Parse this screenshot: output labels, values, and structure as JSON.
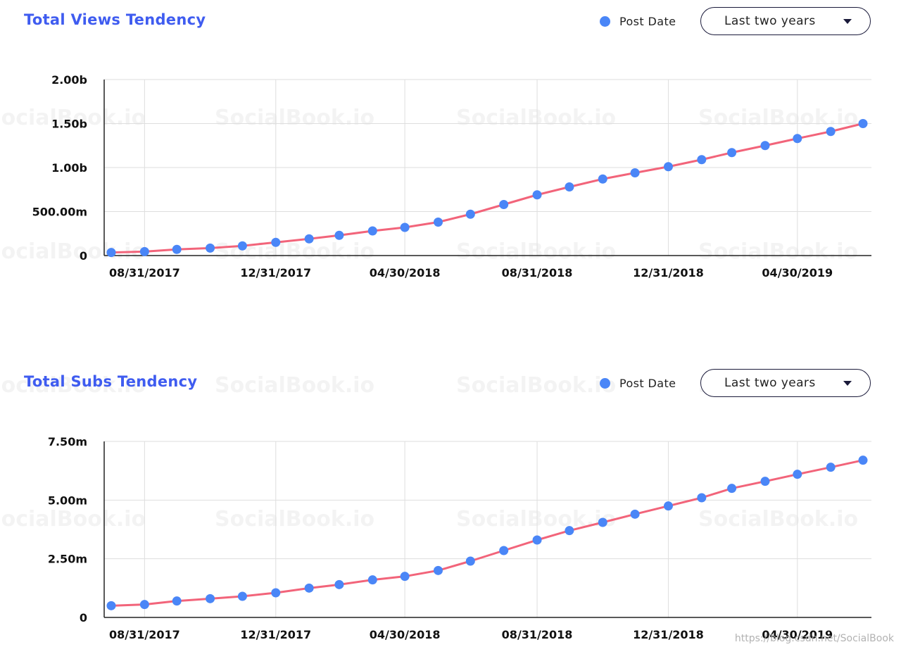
{
  "watermark": "SocialBook.io",
  "footer_credit": "https://blog.csdn.net/SocialBook",
  "accent_color": "#3f5cf0",
  "point_color": "#4a86f7",
  "line_color": "#f2647a",
  "views_panel": {
    "title": "Total Views Tendency",
    "legend_label": "Post Date",
    "dropdown_label": "Last two years"
  },
  "subs_panel": {
    "title": "Total Subs Tendency",
    "legend_label": "Post Date",
    "dropdown_label": "Last two years"
  },
  "chart_data": [
    {
      "type": "line",
      "title": "Total Views Tendency",
      "xlabel": "",
      "ylabel": "",
      "x_tick_labels": [
        "08/31/2017",
        "12/31/2017",
        "04/30/2018",
        "08/31/2018",
        "12/31/2018",
        "04/30/2019"
      ],
      "y_tick_labels": [
        "0",
        "500.00m",
        "1.00b",
        "1.50b",
        "2.00b"
      ],
      "ylim": [
        0,
        2000000000
      ],
      "grid": true,
      "legend": "top-right",
      "series": [
        {
          "name": "Post Date",
          "x": [
            "2017-07-31",
            "2017-08-31",
            "2017-09-30",
            "2017-10-31",
            "2017-11-30",
            "2017-12-31",
            "2018-01-31",
            "2018-02-28",
            "2018-03-31",
            "2018-04-30",
            "2018-05-31",
            "2018-06-30",
            "2018-07-31",
            "2018-08-31",
            "2018-09-30",
            "2018-10-31",
            "2018-11-30",
            "2018-12-31",
            "2019-01-31",
            "2019-02-28",
            "2019-03-31",
            "2019-04-30",
            "2019-05-31",
            "2019-06-30"
          ],
          "values": [
            35000000,
            45000000,
            70000000,
            85000000,
            110000000,
            150000000,
            190000000,
            230000000,
            280000000,
            320000000,
            380000000,
            470000000,
            580000000,
            690000000,
            780000000,
            870000000,
            940000000,
            1010000000,
            1090000000,
            1170000000,
            1250000000,
            1330000000,
            1410000000,
            1500000000
          ]
        }
      ]
    },
    {
      "type": "line",
      "title": "Total Subs Tendency",
      "xlabel": "",
      "ylabel": "",
      "x_tick_labels": [
        "08/31/2017",
        "12/31/2017",
        "04/30/2018",
        "08/31/2018",
        "12/31/2018",
        "04/30/2019"
      ],
      "y_tick_labels": [
        "0",
        "2.50m",
        "5.00m",
        "7.50m"
      ],
      "ylim": [
        0,
        7500000
      ],
      "grid": true,
      "legend": "top-right",
      "series": [
        {
          "name": "Post Date",
          "x": [
            "2017-07-31",
            "2017-08-31",
            "2017-09-30",
            "2017-10-31",
            "2017-11-30",
            "2017-12-31",
            "2018-01-31",
            "2018-02-28",
            "2018-03-31",
            "2018-04-30",
            "2018-05-31",
            "2018-06-30",
            "2018-07-31",
            "2018-08-31",
            "2018-09-30",
            "2018-10-31",
            "2018-11-30",
            "2018-12-31",
            "2019-01-31",
            "2019-02-28",
            "2019-03-31",
            "2019-04-30",
            "2019-05-31",
            "2019-06-30"
          ],
          "values": [
            500000,
            550000,
            700000,
            800000,
            900000,
            1050000,
            1250000,
            1400000,
            1600000,
            1750000,
            2000000,
            2400000,
            2850000,
            3300000,
            3700000,
            4050000,
            4400000,
            4750000,
            5100000,
            5500000,
            5800000,
            6100000,
            6400000,
            6700000
          ]
        }
      ]
    }
  ]
}
